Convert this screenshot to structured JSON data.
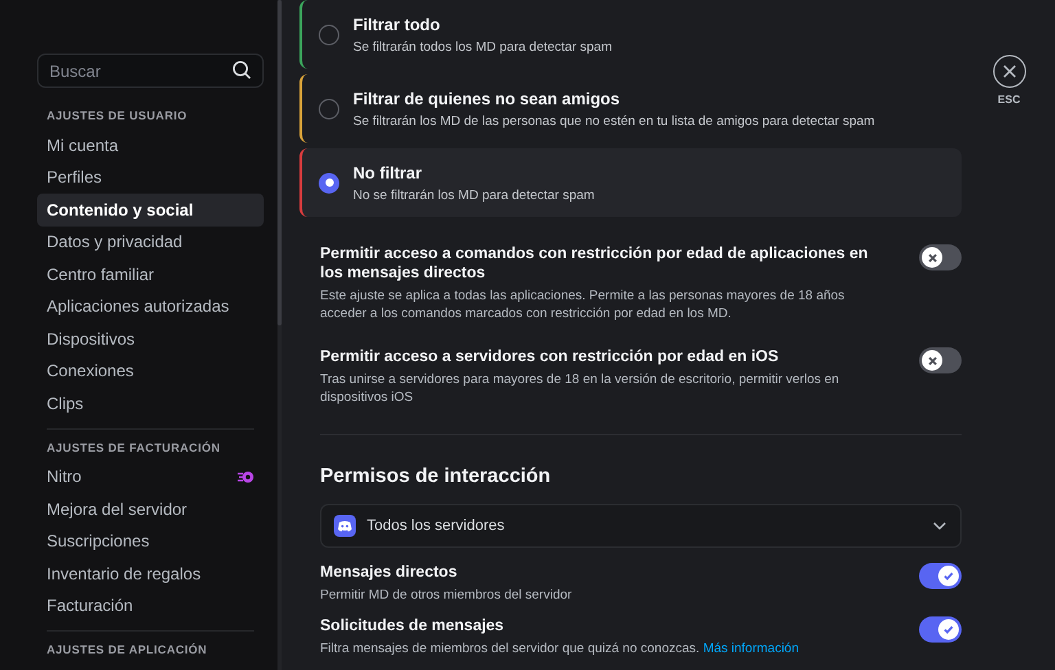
{
  "sidebar": {
    "search": {
      "placeholder": "Buscar"
    },
    "sections": [
      {
        "header": "AJUSTES DE USUARIO",
        "items": [
          {
            "label": "Mi cuenta",
            "selected": false
          },
          {
            "label": "Perfiles",
            "selected": false
          },
          {
            "label": "Contenido y social",
            "selected": true
          },
          {
            "label": "Datos y privacidad",
            "selected": false
          },
          {
            "label": "Centro familiar",
            "selected": false
          },
          {
            "label": "Aplicaciones autorizadas",
            "selected": false
          },
          {
            "label": "Dispositivos",
            "selected": false
          },
          {
            "label": "Conexiones",
            "selected": false
          },
          {
            "label": "Clips",
            "selected": false
          }
        ]
      },
      {
        "header": "AJUSTES DE FACTURACIÓN",
        "items": [
          {
            "label": "Nitro",
            "selected": false,
            "badge": true
          },
          {
            "label": "Mejora del servidor",
            "selected": false
          },
          {
            "label": "Suscripciones",
            "selected": false
          },
          {
            "label": "Inventario de regalos",
            "selected": false
          },
          {
            "label": "Facturación",
            "selected": false
          }
        ]
      },
      {
        "header": "AJUSTES DE APLICACIÓN"
      }
    ]
  },
  "spam_filter": [
    {
      "title": "Filtrar todo",
      "description": "Se filtrarán todos los MD para detectar spam",
      "selected": false,
      "color": "#3ba55c"
    },
    {
      "title": "Filtrar de quienes no sean amigos",
      "description": "Se filtrarán los MD de las personas que no estén en tu lista de amigos para detectar spam",
      "selected": false,
      "color": "#d9a33a"
    },
    {
      "title": "No filtrar",
      "description": "No se filtrarán los MD para detectar spam",
      "selected": true,
      "color": "#d83c3e"
    }
  ],
  "age_settings": [
    {
      "title": "Permitir acceso a comandos con restricción por edad de aplicaciones en los mensajes directos",
      "description": "Este ajuste se aplica a todas las aplicaciones. Permite a las personas mayores de 18 años acceder a los comandos marcados con restricción por edad en los MD.",
      "on": false
    },
    {
      "title": "Permitir acceso a servidores con restricción por edad en iOS",
      "description": "Tras unirse a servidores para mayores de 18 en la versión de escritorio, permitir verlos en dispositivos iOS",
      "on": false
    }
  ],
  "interaction": {
    "heading": "Permisos de interacción",
    "server_select": {
      "value": "Todos los servidores"
    },
    "settings": [
      {
        "title": "Mensajes directos",
        "description": "Permitir MD de otros miembros del servidor",
        "on": true
      },
      {
        "title": "Solicitudes de mensajes",
        "description": "Filtra mensajes de miembros del servidor que quizá no conozcas.",
        "link": "Más información",
        "on": true
      }
    ]
  },
  "close": {
    "label": "ESC"
  }
}
